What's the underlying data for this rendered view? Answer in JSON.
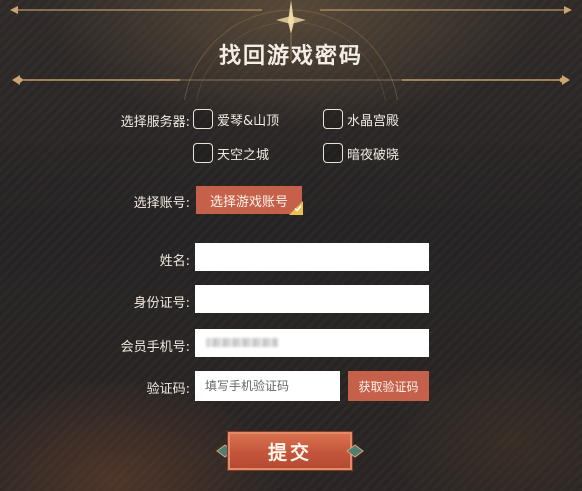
{
  "title": "找回游戏密码",
  "server": {
    "label": "选择服务器:",
    "options": [
      {
        "label": "爱琴&山顶",
        "checked": false
      },
      {
        "label": "水晶宫殿",
        "checked": false
      },
      {
        "label": "天空之城",
        "checked": false
      },
      {
        "label": "暗夜破晓",
        "checked": false
      }
    ]
  },
  "account": {
    "label": "选择账号:",
    "button_label": "选择游戏账号"
  },
  "fields": {
    "name_label": "姓名:",
    "name_value": "",
    "id_label": "身份证号:",
    "id_value": "",
    "phone_label": "会员手机号:",
    "phone_value": "",
    "code_label": "验证码:",
    "code_placeholder": "填写手机验证码",
    "code_value": ""
  },
  "get_code_label": "获取验证码",
  "submit_label": "提交",
  "colors": {
    "accent": "#c5614a",
    "gold": "#d6b27a",
    "background": "#2a2624"
  }
}
